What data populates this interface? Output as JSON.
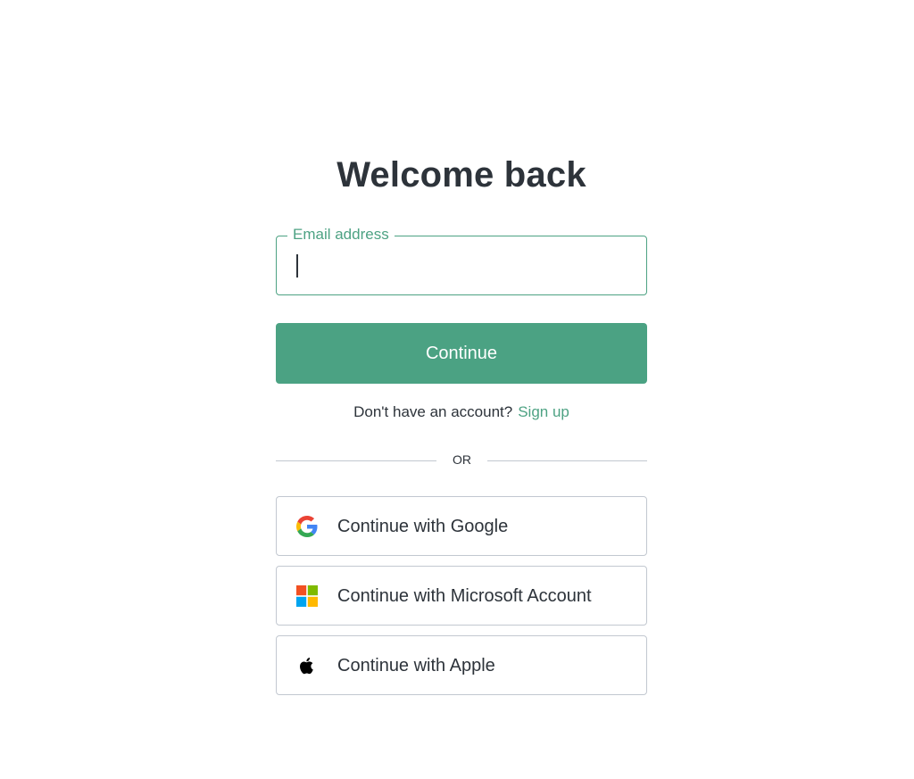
{
  "login": {
    "title": "Welcome back",
    "email_label": "Email address",
    "email_value": "",
    "continue_label": "Continue",
    "signup_prompt": "Don't have an account?",
    "signup_link": "Sign up",
    "divider_text": "OR"
  },
  "social": {
    "google_label": "Continue with Google",
    "google_icon": "google-icon",
    "microsoft_label": "Continue with Microsoft Account",
    "microsoft_icon": "microsoft-icon",
    "apple_label": "Continue with Apple",
    "apple_icon": "apple-icon"
  },
  "colors": {
    "accent": "#4ba283",
    "text": "#2d333a",
    "border": "#c2c8d0",
    "microsoft_red": "#f25022",
    "microsoft_green": "#7fba00",
    "microsoft_blue": "#00a4ef",
    "microsoft_yellow": "#ffb900"
  }
}
